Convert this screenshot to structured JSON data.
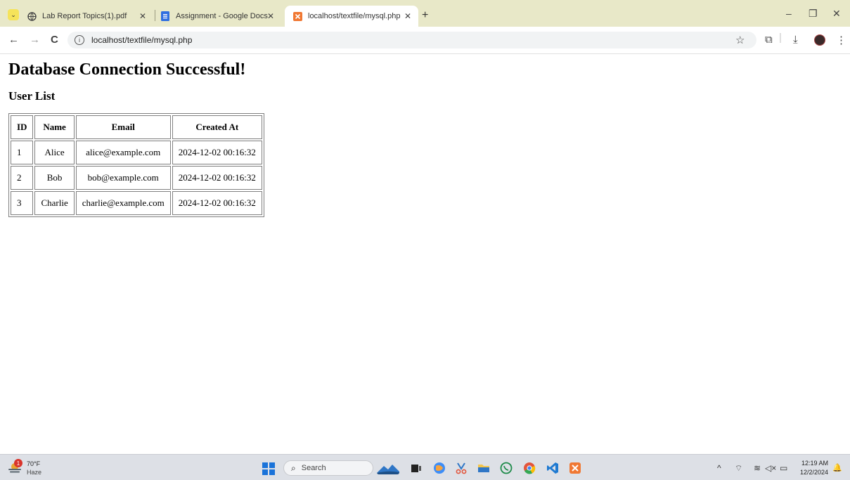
{
  "browser": {
    "tabs": [
      {
        "title": "Lab Report Topics(1).pdf",
        "favicon": "globe-icon"
      },
      {
        "title": "Assignment - Google Docs",
        "favicon": "docs-icon"
      },
      {
        "title": "localhost/textfile/mysql.php",
        "favicon": "xampp-icon",
        "active": true
      }
    ],
    "address": "localhost/textfile/mysql.php",
    "nav_icons": {
      "back": "←",
      "forward": "→",
      "reload": "C",
      "info": "i"
    },
    "window_controls": {
      "minimize": "–",
      "restore": "❐",
      "close": "✕"
    },
    "toolbar_icons": {
      "bookmark": "☆",
      "extensions": "⧉",
      "download": "⤓",
      "menu": "⋮"
    },
    "new_tab": "+",
    "tab_close": "✕",
    "tab_menu": "⌄"
  },
  "page": {
    "heading": "Database Connection Successful!",
    "subheading": "User List",
    "table": {
      "headers": [
        "ID",
        "Name",
        "Email",
        "Created At"
      ],
      "rows": [
        [
          "1",
          "Alice",
          "alice@example.com",
          "2024-12-02 00:16:32"
        ],
        [
          "2",
          "Bob",
          "bob@example.com",
          "2024-12-02 00:16:32"
        ],
        [
          "3",
          "Charlie",
          "charlie@example.com",
          "2024-12-02 00:16:32"
        ]
      ]
    }
  },
  "taskbar": {
    "weather_temp": "70°F",
    "weather_condition": "Haze",
    "weather_badge": "1",
    "search_placeholder": "Search",
    "search_icon": "⌕",
    "tray_icons": {
      "chevron": "^",
      "network": "⌔",
      "wifi": "≋",
      "volume": "◁×",
      "battery": "▭",
      "bell": "🔔"
    },
    "clock_time": "12:19 AM",
    "clock_date": "12/2/2024"
  }
}
